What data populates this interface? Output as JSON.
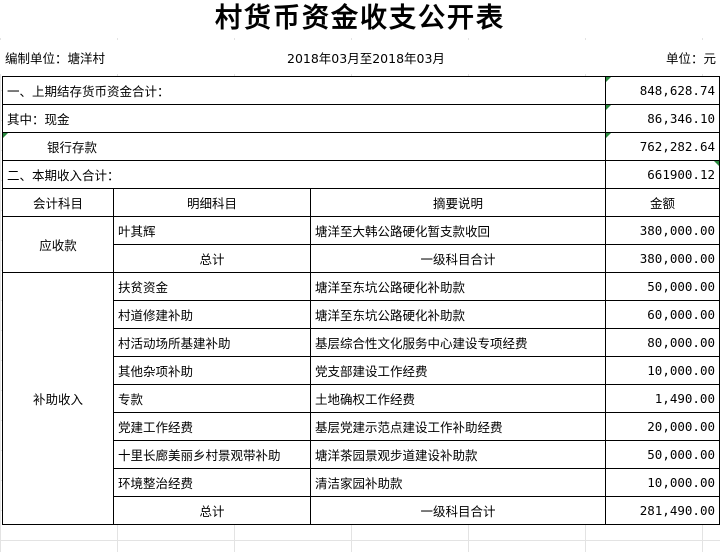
{
  "title": "村货币资金收支公开表",
  "header": {
    "unit_org": "编制单位：塘洋村",
    "period": "2018年03月至2018年03月",
    "currency": "单位：元"
  },
  "summary": {
    "prev_balance_label": "一、上期结存货币资金合计：",
    "prev_balance_value": "848,628.74",
    "cash_label": "其中：现金",
    "cash_value": "86,346.10",
    "bank_label": "银行存款",
    "bank_value": "762,282.64",
    "income_label": "二、本期收入合计：",
    "income_value": "661900.12"
  },
  "columns": [
    "会计科目",
    "明细科目",
    "摘要说明",
    "金额"
  ],
  "receivables": {
    "account": "应收款",
    "rows": [
      {
        "detail": "叶其辉",
        "desc": "塘洋至大韩公路硬化暂支款收回",
        "amount": "380,000.00"
      }
    ],
    "total_label": "总计",
    "total_desc": "一级科目合计",
    "total_amount": "380,000.00"
  },
  "subsidy": {
    "account": "补助收入",
    "rows": [
      {
        "detail": "扶贫资金",
        "desc": "塘洋至东坑公路硬化补助款",
        "amount": "50,000.00"
      },
      {
        "detail": "村道修建补助",
        "desc": "塘洋至东坑公路硬化补助款",
        "amount": "60,000.00"
      },
      {
        "detail": "村活动场所基建补助",
        "desc": "基层综合性文化服务中心建设专项经费",
        "amount": "80,000.00"
      },
      {
        "detail": "其他杂项补助",
        "desc": "党支部建设工作经费",
        "amount": "10,000.00"
      },
      {
        "detail": "专款",
        "desc": "土地确权工作经费",
        "amount": "1,490.00"
      },
      {
        "detail": "党建工作经费",
        "desc": "基层党建示范点建设工作补助经费",
        "amount": "20,000.00"
      },
      {
        "detail": "十里长廊美丽乡村景观带补助",
        "desc": "塘洋茶园景观步道建设补助款",
        "amount": "50,000.00"
      },
      {
        "detail": "环境整治经费",
        "desc": "清洁家园补助款",
        "amount": "10,000.00"
      }
    ],
    "total_label": "总计",
    "total_desc": "一级科目合计",
    "total_amount": "281,490.00"
  },
  "colors": {
    "selection": "#1e7b3a",
    "error_marker": "#2a8a3e",
    "gridline": "#e3e3e3"
  }
}
